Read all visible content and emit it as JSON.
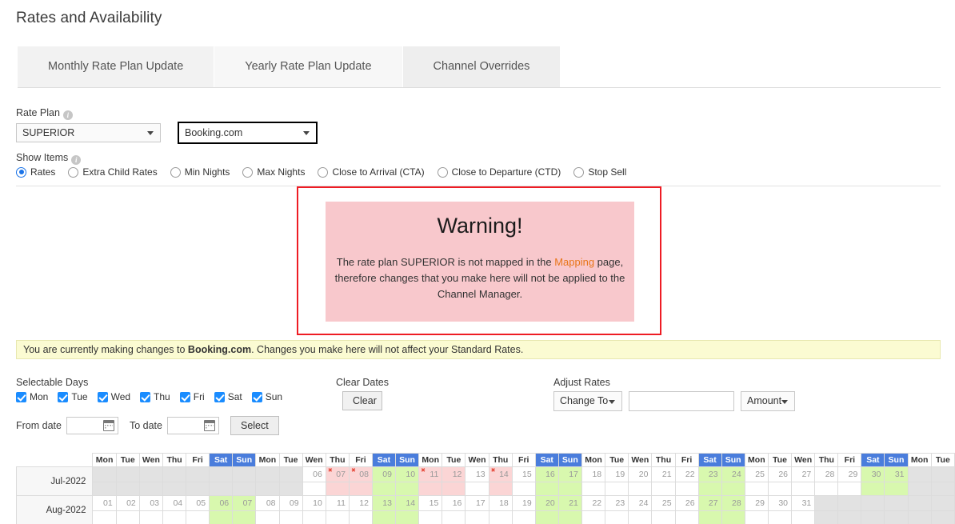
{
  "page": {
    "title": "Rates and Availability"
  },
  "tabs": [
    {
      "label": "Monthly Rate Plan Update",
      "active": true
    },
    {
      "label": "Yearly Rate Plan Update",
      "active": false
    },
    {
      "label": "Channel Overrides",
      "active": false
    }
  ],
  "form": {
    "rate_plan_label": "Rate Plan",
    "rate_plan_value": "SUPERIOR",
    "channel_value": "Booking.com",
    "show_items_label": "Show Items",
    "show_items": [
      {
        "label": "Rates",
        "selected": true
      },
      {
        "label": "Extra Child Rates",
        "selected": false
      },
      {
        "label": "Min Nights",
        "selected": false
      },
      {
        "label": "Max Nights",
        "selected": false
      },
      {
        "label": "Close to Arrival (CTA)",
        "selected": false
      },
      {
        "label": "Close to Departure (CTD)",
        "selected": false
      },
      {
        "label": "Stop Sell",
        "selected": false
      }
    ]
  },
  "warning": {
    "title": "Warning!",
    "text_before": "The rate plan SUPERIOR is not mapped in the ",
    "link": "Mapping",
    "text_after": " page, therefore changes that you make here will not be applied to the Channel Manager.",
    "border_color": "#ee1c24",
    "fill_color": "#f8c8cc",
    "link_color": "#e8761a"
  },
  "notice": {
    "text_before": "You are currently making changes to ",
    "bold": "Booking.com",
    "text_after": ". Changes you make here will not affect your Standard Rates.",
    "background": "#fbfbd2"
  },
  "controls": {
    "selectable_days_label": "Selectable Days",
    "days": [
      {
        "label": "Mon",
        "checked": true
      },
      {
        "label": "Tue",
        "checked": true
      },
      {
        "label": "Wed",
        "checked": true
      },
      {
        "label": "Thu",
        "checked": true
      },
      {
        "label": "Fri",
        "checked": true
      },
      {
        "label": "Sat",
        "checked": true
      },
      {
        "label": "Sun",
        "checked": true
      }
    ],
    "from_date_label": "From date",
    "from_date_value": "",
    "to_date_label": "To date",
    "to_date_value": "",
    "select_button": "Select",
    "clear_dates_label": "Clear Dates",
    "clear_button": "Clear",
    "adjust_rates_label": "Adjust Rates",
    "adjust_mode": "Change To",
    "adjust_amount_value": "",
    "adjust_type": "Amount"
  },
  "calendar": {
    "weekday_columns": [
      "Mon",
      "Tue",
      "Wen",
      "Thu",
      "Fri",
      "Sat",
      "Sun",
      "Mon",
      "Tue",
      "Wen",
      "Thu",
      "Fri",
      "Sat",
      "Sun",
      "Mon",
      "Tue",
      "Wen",
      "Thu",
      "Fri",
      "Sat",
      "Sun",
      "Mon",
      "Tue",
      "Wen",
      "Thu",
      "Fri",
      "Sat",
      "Sun",
      "Mon",
      "Tue",
      "Wen",
      "Thu",
      "Fri",
      "Sat",
      "Sun",
      "Mon",
      "Tue"
    ],
    "weekend_indices": [
      5,
      6,
      12,
      13,
      19,
      20,
      26,
      27,
      33,
      34
    ],
    "rows": [
      {
        "month": "Jul-2022",
        "cells": [
          {
            "d": "",
            "s": "blank"
          },
          {
            "d": "",
            "s": "blank"
          },
          {
            "d": "",
            "s": "blank"
          },
          {
            "d": "",
            "s": "blank"
          },
          {
            "d": "",
            "s": "blank"
          },
          {
            "d": "",
            "s": "blank"
          },
          {
            "d": "",
            "s": "blank"
          },
          {
            "d": "",
            "s": "blank"
          },
          {
            "d": "",
            "s": "blank"
          },
          {
            "d": "06",
            "s": "white"
          },
          {
            "d": "07",
            "s": "pink",
            "x": true
          },
          {
            "d": "08",
            "s": "pink",
            "x": true
          },
          {
            "d": "09",
            "s": "green"
          },
          {
            "d": "10",
            "s": "green"
          },
          {
            "d": "11",
            "s": "pink",
            "x": true
          },
          {
            "d": "12",
            "s": "pink"
          },
          {
            "d": "13",
            "s": "white"
          },
          {
            "d": "14",
            "s": "pink",
            "x": true
          },
          {
            "d": "15",
            "s": "white"
          },
          {
            "d": "16",
            "s": "green"
          },
          {
            "d": "17",
            "s": "green"
          },
          {
            "d": "18",
            "s": "white"
          },
          {
            "d": "19",
            "s": "white"
          },
          {
            "d": "20",
            "s": "white"
          },
          {
            "d": "21",
            "s": "white"
          },
          {
            "d": "22",
            "s": "white"
          },
          {
            "d": "23",
            "s": "green"
          },
          {
            "d": "24",
            "s": "green"
          },
          {
            "d": "25",
            "s": "white"
          },
          {
            "d": "26",
            "s": "white"
          },
          {
            "d": "27",
            "s": "white"
          },
          {
            "d": "28",
            "s": "white"
          },
          {
            "d": "29",
            "s": "white"
          },
          {
            "d": "30",
            "s": "green"
          },
          {
            "d": "31",
            "s": "green"
          },
          {
            "d": "",
            "s": "blank"
          },
          {
            "d": "",
            "s": "blank"
          }
        ]
      },
      {
        "month": "Aug-2022",
        "cells": [
          {
            "d": "01",
            "s": "white"
          },
          {
            "d": "02",
            "s": "white"
          },
          {
            "d": "03",
            "s": "white"
          },
          {
            "d": "04",
            "s": "white"
          },
          {
            "d": "05",
            "s": "white"
          },
          {
            "d": "06",
            "s": "green"
          },
          {
            "d": "07",
            "s": "green"
          },
          {
            "d": "08",
            "s": "white"
          },
          {
            "d": "09",
            "s": "white"
          },
          {
            "d": "10",
            "s": "white"
          },
          {
            "d": "11",
            "s": "white"
          },
          {
            "d": "12",
            "s": "white"
          },
          {
            "d": "13",
            "s": "green"
          },
          {
            "d": "14",
            "s": "green"
          },
          {
            "d": "15",
            "s": "white"
          },
          {
            "d": "16",
            "s": "white"
          },
          {
            "d": "17",
            "s": "white"
          },
          {
            "d": "18",
            "s": "white"
          },
          {
            "d": "19",
            "s": "white"
          },
          {
            "d": "20",
            "s": "green"
          },
          {
            "d": "21",
            "s": "green"
          },
          {
            "d": "22",
            "s": "white"
          },
          {
            "d": "23",
            "s": "white"
          },
          {
            "d": "24",
            "s": "white"
          },
          {
            "d": "25",
            "s": "white"
          },
          {
            "d": "26",
            "s": "white"
          },
          {
            "d": "27",
            "s": "green"
          },
          {
            "d": "28",
            "s": "green"
          },
          {
            "d": "29",
            "s": "white"
          },
          {
            "d": "30",
            "s": "white"
          },
          {
            "d": "31",
            "s": "white"
          },
          {
            "d": "",
            "s": "blank"
          },
          {
            "d": "",
            "s": "blank"
          },
          {
            "d": "",
            "s": "blank"
          },
          {
            "d": "",
            "s": "blank"
          },
          {
            "d": "",
            "s": "blank"
          },
          {
            "d": "",
            "s": "blank"
          }
        ]
      }
    ]
  }
}
